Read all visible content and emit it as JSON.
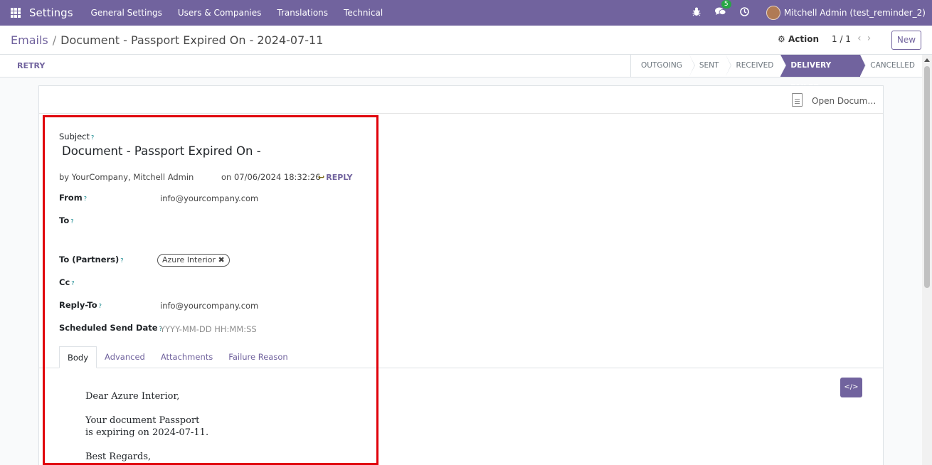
{
  "navbar": {
    "brand": "Settings",
    "menu": [
      "General Settings",
      "Users & Companies",
      "Translations",
      "Technical"
    ],
    "messages_badge": "5",
    "user": "Mitchell Admin (test_reminder_2)",
    "accent_color": "#71639e"
  },
  "control": {
    "breadcrumb_parent": "Emails",
    "breadcrumb_current": "Document - Passport Expired On - 2024-07-11",
    "action_label": "Action",
    "pager": "1 / 1",
    "new_label": "New"
  },
  "statusbar": {
    "retry_label": "RETRY",
    "stages": [
      "OUTGOING",
      "SENT",
      "RECEIVED",
      "DELIVERY FAILED",
      "CANCELLED"
    ],
    "active_stage": "DELIVERY FAILED"
  },
  "sheet": {
    "open_document": "Open Docum…",
    "subject_label": "Subject",
    "tooltip_mark": "?",
    "subject_value": "Document - Passport Expired On -",
    "by_line": "by  YourCompany, Mitchell Admin",
    "on_line": "on 07/06/2024 18:32:26",
    "reply_label": "REPLY",
    "fields": {
      "from_label": "From",
      "from_value": "info@yourcompany.com",
      "to_label": "To",
      "to_partners_label": "To (Partners)",
      "to_partners_tag": "Azure Interior",
      "cc_label": "Cc",
      "reply_to_label": "Reply-To",
      "reply_to_value": "info@yourcompany.com",
      "scheduled_label": "Scheduled Send Date",
      "scheduled_placeholder": "YYYY-MM-DD HH:MM:SS"
    },
    "tabs": [
      "Body",
      "Advanced",
      "Attachments",
      "Failure Reason"
    ],
    "active_tab": "Body",
    "body": {
      "greeting": "Dear Azure Interior,",
      "line1": "Your document Passport",
      "line2": "is expiring on 2024-07-11.",
      "closing": "Best Regards,"
    }
  }
}
